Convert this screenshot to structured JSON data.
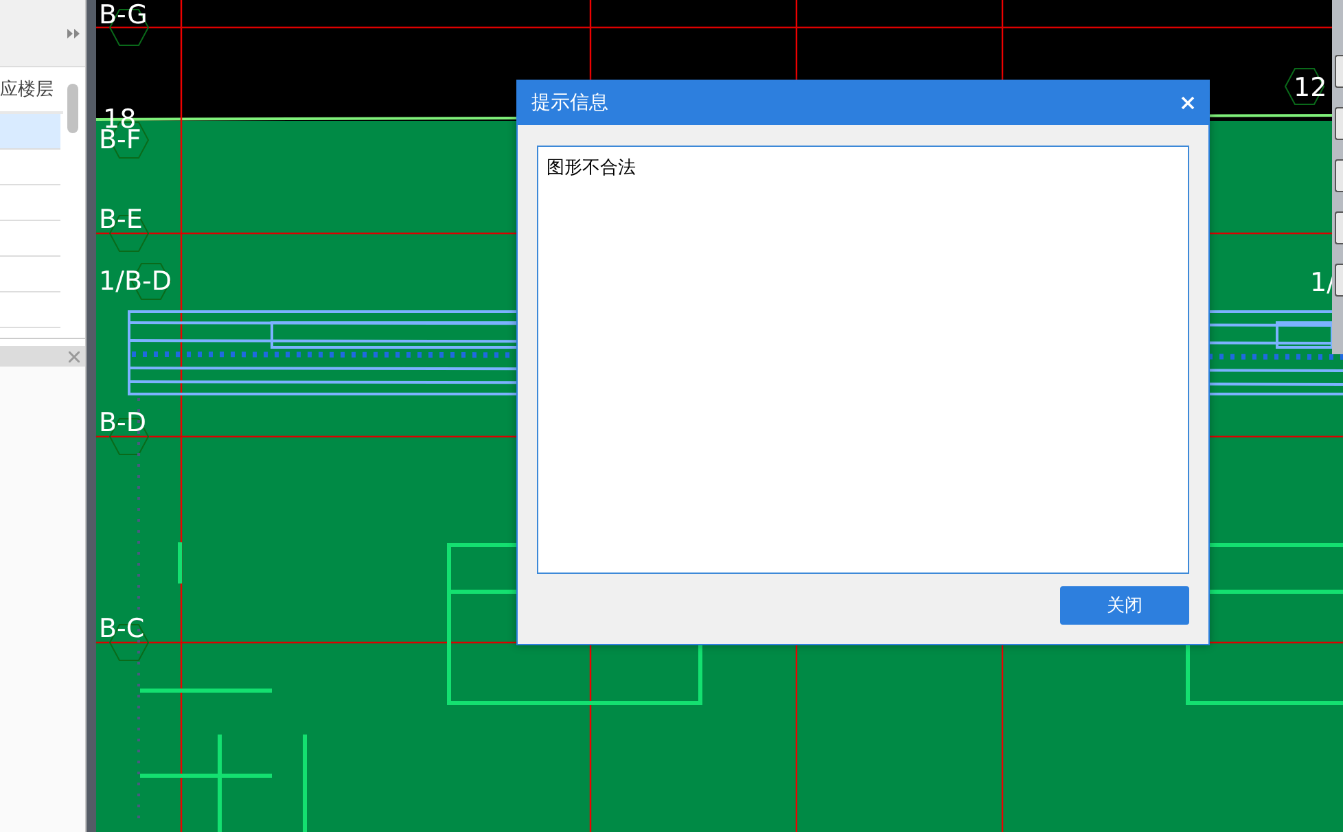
{
  "floor_panel": {
    "header": "应楼层",
    "rows": [
      {
        "selected": true
      },
      {
        "selected": false
      },
      {
        "selected": false
      },
      {
        "selected": false
      },
      {
        "selected": false
      },
      {
        "selected": false
      }
    ]
  },
  "canvas": {
    "axis_labels": [
      "B-G",
      "18",
      "B-F",
      "B-E",
      "1/B-D",
      "B-D",
      "B-C",
      "12",
      "1/"
    ]
  },
  "dialog": {
    "title": "提示信息",
    "message": "图形不合法",
    "button": "关闭"
  }
}
